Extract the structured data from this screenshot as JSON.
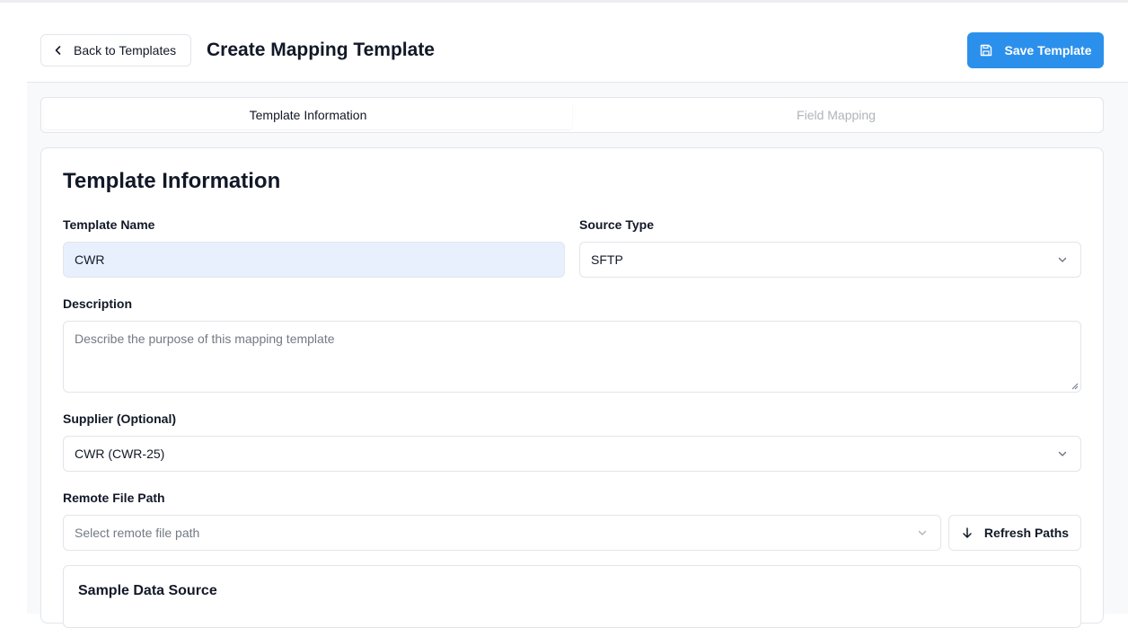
{
  "header": {
    "back_label": "Back to Templates",
    "title": "Create Mapping Template",
    "save_label": "Save Template"
  },
  "tabs": [
    {
      "label": "Template Information",
      "active": true
    },
    {
      "label": "Field Mapping",
      "active": false
    }
  ],
  "form": {
    "section_title": "Template Information",
    "template_name": {
      "label": "Template Name",
      "value": "CWR"
    },
    "source_type": {
      "label": "Source Type",
      "value": "SFTP"
    },
    "description": {
      "label": "Description",
      "placeholder": "Describe the purpose of this mapping template"
    },
    "supplier": {
      "label": "Supplier (Optional)",
      "value": "CWR (CWR-25)"
    },
    "remote_path": {
      "label": "Remote File Path",
      "placeholder": "Select remote file path"
    },
    "refresh_label": "Refresh Paths",
    "sample_title": "Sample Data Source"
  },
  "colors": {
    "accent": "#2b90ec",
    "filled_input": "#e8f0fe",
    "surface": "#f8f9fb"
  },
  "icons": [
    "chevron-left-icon",
    "save-icon",
    "chevron-down-icon",
    "arrow-down-icon",
    "resize-handle-icon"
  ]
}
